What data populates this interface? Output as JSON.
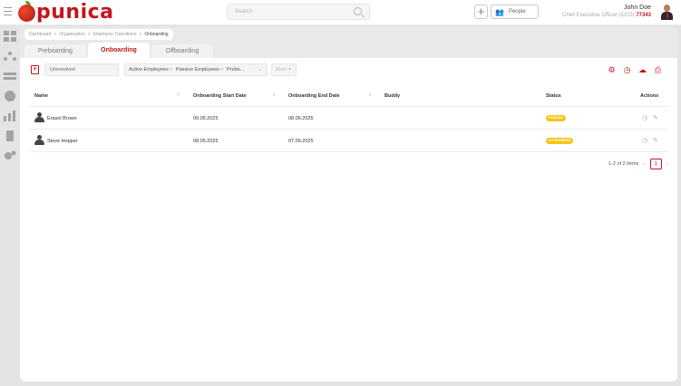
{
  "app": {
    "brand": "punica",
    "brand_color": "#c4161c"
  },
  "header": {
    "search_placeholder": "Search",
    "people_label": "People",
    "user_name": "John Doe",
    "user_role": "Chief Executive Officer (CEO)",
    "user_id": "77343"
  },
  "breadcrumb": {
    "items": [
      "Dashboard",
      "Organisation",
      "Employee Transitions",
      "Onboarding"
    ],
    "separator": ">"
  },
  "tabs": [
    {
      "label": "Preboarding",
      "active": false
    },
    {
      "label": "Onboarding",
      "active": true
    },
    {
      "label": "Offboarding",
      "active": false
    }
  ],
  "toolbar": {
    "add_icon": "plus-square-icon",
    "status_filter": "Unresolved",
    "tag_filters": [
      "Active Employees",
      "Passive Employees",
      "Prebo..."
    ],
    "more_label": "More"
  },
  "table": {
    "columns": [
      "Name",
      "Onboarding Start Date",
      "Onboarding End Date",
      "Buddy",
      "Status",
      "Actions"
    ],
    "rows": [
      {
        "name": "Erasol Brown",
        "start": "09.05.2025",
        "end": "08.06.2025",
        "buddy": "",
        "status": "PENDING"
      },
      {
        "name": "Steve Hopper",
        "start": "08.05.2025",
        "end": "07.06.2025",
        "buddy": "",
        "status": "IN PROGRESS"
      }
    ],
    "status_color": "#f5c518"
  },
  "pagination": {
    "info": "1-2 of 2 items",
    "current_page": "1",
    "prev": "‹",
    "next": "›"
  }
}
